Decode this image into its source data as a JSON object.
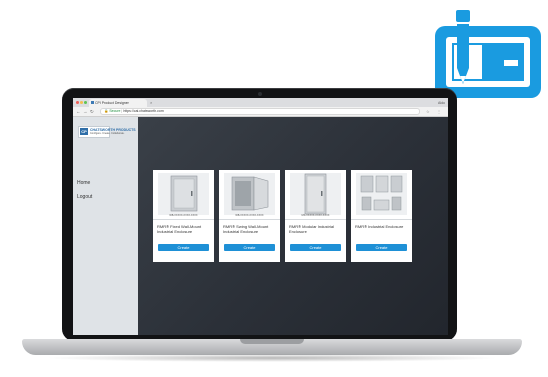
{
  "browser": {
    "tab_title": "CPI Product Designer",
    "tab_close": "×",
    "user_label": "Aldo",
    "secure_label": "Secure",
    "url": "https://cai.chatsworth.com",
    "nav_icons": [
      "back-icon",
      "forward-icon",
      "reload-icon"
    ],
    "bar_icons": [
      "star-icon",
      "menu-icon"
    ]
  },
  "brand": {
    "mark": "CP",
    "name": "CHATSWORTH PRODUCTS",
    "tagline": "Configure. Create. Collaborate."
  },
  "sidebar": {
    "items": [
      {
        "label": "Home"
      },
      {
        "label": "Logout"
      }
    ]
  },
  "products": [
    {
      "code": "WB-XXXXX-XXXX-XXXX",
      "title": "RMR® Fixed Wall-Mount Industrial Enclosure",
      "button": "Create"
    },
    {
      "code": "WB-XXXXX-XXXX-XXXX",
      "title": "RMR® Swing Wall-Mount Industrial Enclosure",
      "button": "Create"
    },
    {
      "code": "MS-XXXXX-XXXX-XXXX",
      "title": "RMR® Modular Industrial Enclosure",
      "button": "Create"
    },
    {
      "code": "",
      "title": "RMR® Industrial Enclosure",
      "button": "Create"
    }
  ],
  "colors": {
    "accent": "#1e90d6",
    "logo_blue": "#1a9be0",
    "sidebar": "#dfe3e7",
    "main_bg": "#2b3038"
  }
}
